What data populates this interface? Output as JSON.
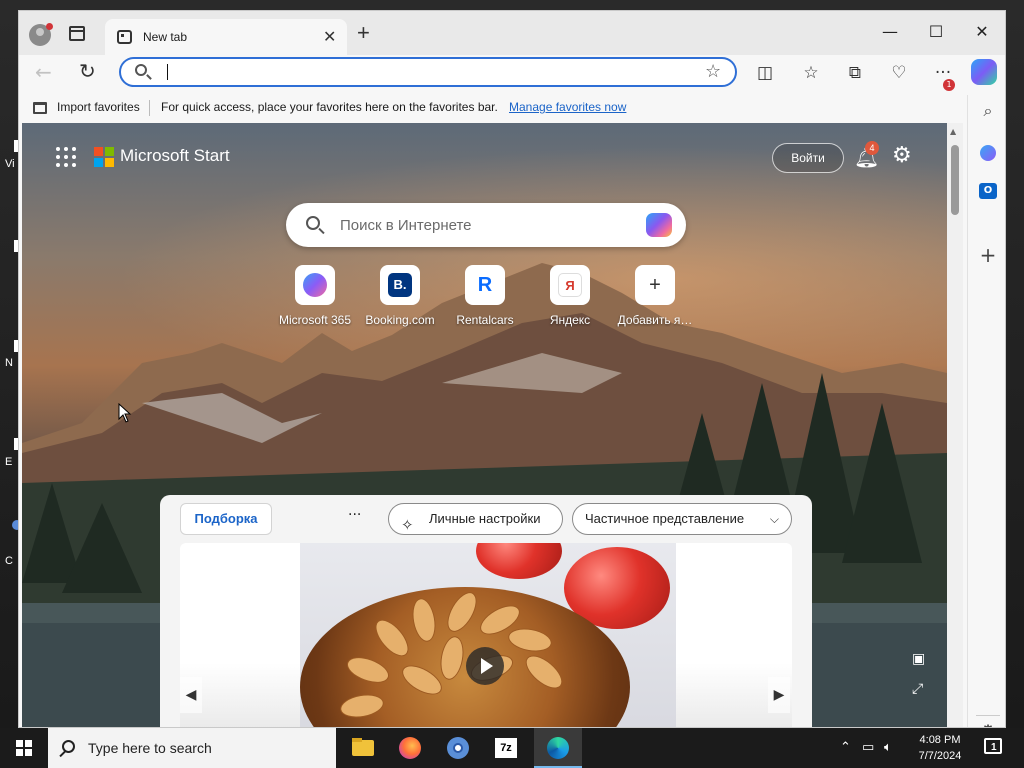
{
  "desktop": {
    "fragments": [
      {
        "text": "Vi"
      },
      {
        "text": "N"
      },
      {
        "text": "E"
      },
      {
        "text": "C"
      }
    ]
  },
  "browser": {
    "tab": {
      "title": "New tab"
    },
    "window_controls": {
      "minimize": "—",
      "maximize": "☐",
      "close": "✕"
    },
    "address": {
      "value": "",
      "placeholder": ""
    },
    "favorites_bar": {
      "import_label": "Import favorites",
      "message": "For quick access, place your favorites here on the favorites bar.",
      "manage_link": "Manage favorites now"
    },
    "more_badge": "1"
  },
  "start_page": {
    "brand": "Microsoft Start",
    "signin_label": "Войти",
    "notifications_count": "4",
    "search_placeholder": "Поиск в Интернете",
    "quick_links": [
      {
        "label": "Microsoft 365",
        "glyph": "◆",
        "color": "#7b61ff"
      },
      {
        "label": "Booking.com",
        "glyph": "B.",
        "color": "#003580"
      },
      {
        "label": "Rentalcars",
        "glyph": "R",
        "color": "#0a6cff"
      },
      {
        "label": "Яндекс",
        "glyph": "Я",
        "color": "#d63b2f"
      },
      {
        "label": "Добавить я…",
        "glyph": "+",
        "color": "#333333"
      }
    ],
    "feed": {
      "tab_active": "Подборка",
      "more": "···",
      "personal_settings": "Личные настройки",
      "view_mode": "Частичное представление"
    }
  },
  "taskbar": {
    "search_placeholder": "Type here to search",
    "time": "4:08 PM",
    "date": "7/7/2024",
    "notifications": "1"
  },
  "colors": {
    "accent": "#2f6fd6",
    "link": "#1b64c8",
    "badge_red": "#d13438",
    "ms_red": "#f25022",
    "ms_green": "#7fba00",
    "ms_blue": "#00a4ef",
    "ms_yellow": "#ffb900"
  },
  "icons": {
    "profile": "profile-avatar-icon",
    "tabs": "tab-actions-icon",
    "reload": "refresh-icon",
    "favorite": "star-icon",
    "split": "split-screen-icon",
    "favorites": "favorites-icon",
    "collections": "collections-icon",
    "performance": "heart-pulse-icon",
    "more": "ellipsis-icon",
    "copilot": "copilot-icon"
  }
}
